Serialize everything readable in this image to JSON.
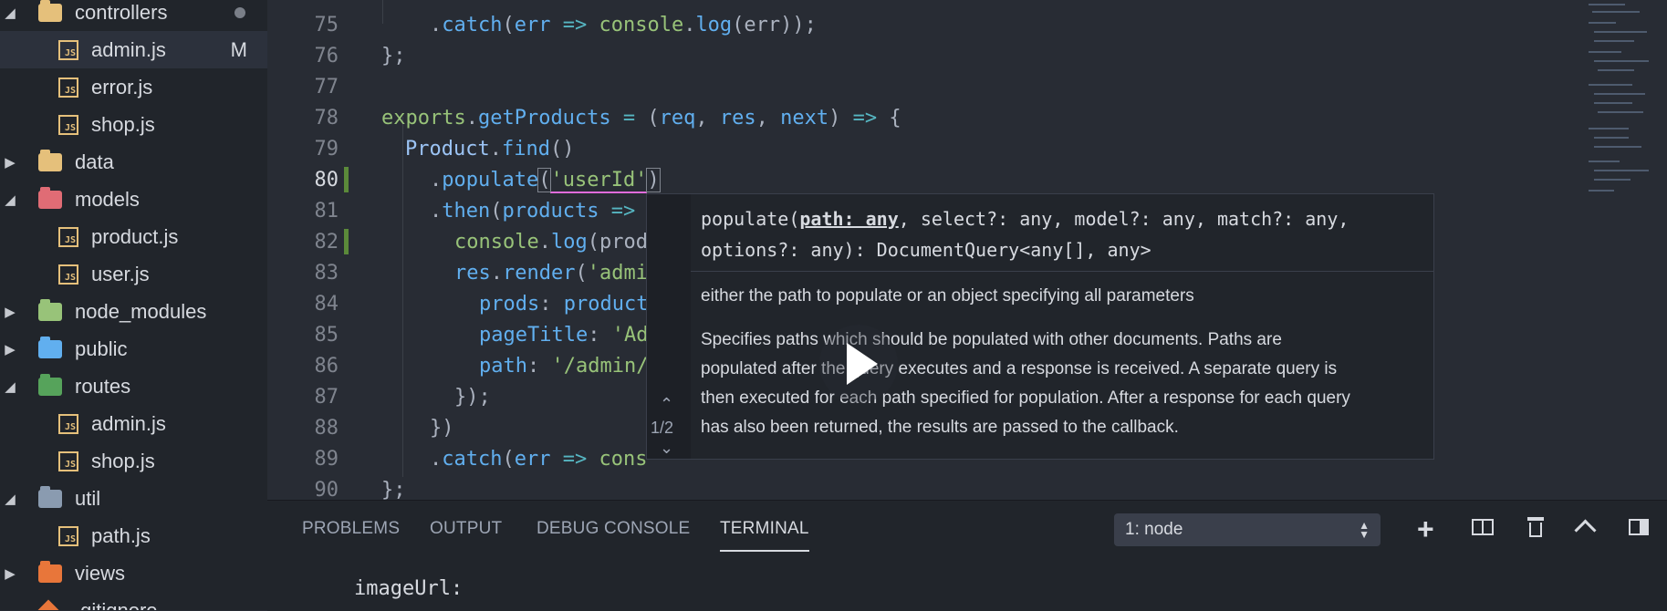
{
  "explorer": {
    "items": [
      {
        "label": "controllers",
        "type": "folder",
        "expanded": true,
        "folder_color": "#e5c07b",
        "badge": "dot"
      },
      {
        "label": "admin.js",
        "type": "js",
        "badge": "M",
        "selected": true
      },
      {
        "label": "error.js",
        "type": "js"
      },
      {
        "label": "shop.js",
        "type": "js"
      },
      {
        "label": "data",
        "type": "folder",
        "expanded": false,
        "folder_color": "#e5c07b"
      },
      {
        "label": "models",
        "type": "folder",
        "expanded": true,
        "folder_color": "#e06c75"
      },
      {
        "label": "product.js",
        "type": "js"
      },
      {
        "label": "user.js",
        "type": "js"
      },
      {
        "label": "node_modules",
        "type": "folder",
        "expanded": false,
        "folder_color": "#98c379"
      },
      {
        "label": "public",
        "type": "folder",
        "expanded": false,
        "folder_color": "#61afef"
      },
      {
        "label": "routes",
        "type": "folder",
        "expanded": true,
        "folder_color": "#56a35b"
      },
      {
        "label": "admin.js",
        "type": "js"
      },
      {
        "label": "shop.js",
        "type": "js"
      },
      {
        "label": "util",
        "type": "folder",
        "expanded": true,
        "folder_color": "#8a9bb0"
      },
      {
        "label": "path.js",
        "type": "js"
      },
      {
        "label": "views",
        "type": "folder",
        "expanded": false,
        "folder_color": "#e8763a"
      },
      {
        "label": ".gitignore",
        "type": "git"
      }
    ],
    "js_badge_text": "JS"
  },
  "editor": {
    "line_numbers": [
      "75",
      "76",
      "77",
      "78",
      "79",
      "80",
      "81",
      "82",
      "83",
      "84",
      "85",
      "86",
      "87",
      "88",
      "89",
      "90"
    ],
    "lines": {
      "l75": {
        "a": ".",
        "b": "catch",
        "c": "(",
        "d": "err",
        "e": " => ",
        "f": "console",
        "g": ".",
        "h": "log",
        "i": "(err));"
      },
      "l76": {
        "a": "};"
      },
      "l78": {
        "a": "exports",
        "b": ".",
        "c": "getProducts",
        "d": " = ",
        "e": "(",
        "f": "req",
        "g": ", ",
        "h": "res",
        "i": ", ",
        "j": "next",
        "k": ") ",
        "l": "=>",
        "m": " {"
      },
      "l79": {
        "a": "Product",
        "b": ".",
        "c": "find",
        "d": "()"
      },
      "l80": {
        "a": ".",
        "b": "populate",
        "c": "(",
        "d": "'userId'",
        "e": ")"
      },
      "l81": {
        "a": ".",
        "b": "then",
        "c": "(",
        "d": "products",
        "e": " =>"
      },
      "l82": {
        "a": "console",
        "b": ".",
        "c": "log",
        "d": "(prod"
      },
      "l83": {
        "a": "res",
        "b": ".",
        "c": "render",
        "d": "(",
        "e": "'admi"
      },
      "l84": {
        "a": "prods",
        "b": ": ",
        "c": "product"
      },
      "l85": {
        "a": "pageTitle",
        "b": ": ",
        "c": "'Ad"
      },
      "l86": {
        "a": "path",
        "b": ": ",
        "c": "'/admin/"
      },
      "l87": {
        "a": "});"
      },
      "l88": {
        "a": "})"
      },
      "l89": {
        "a": ".",
        "b": "catch",
        "c": "(",
        "d": "err",
        "e": " => ",
        "f": "cons"
      },
      "l90": {
        "a": "};"
      }
    }
  },
  "hover": {
    "nav_count": "1/2",
    "sig_prefix": "populate(",
    "sig_param": "path: any",
    "sig_rest": ", select?: any, model?: any, match?: any,",
    "sig_line2": "options?: any): DocumentQuery<any[], any>",
    "doc_short": "either the path to populate or an object specifying all parameters",
    "doc_long": [
      "Specifies paths which should be populated with other documents. Paths are",
      "populated after the query executes and a response is received. A separate query is",
      "then executed for each path specified for population. After a response for each query",
      "has also been returned, the results are passed to the callback."
    ]
  },
  "panel": {
    "tabs": [
      "PROBLEMS",
      "OUTPUT",
      "DEBUG CONSOLE",
      "TERMINAL"
    ],
    "active_tab": "TERMINAL",
    "terminal_select": "1: node",
    "terminal_output": "imageUrl:"
  }
}
